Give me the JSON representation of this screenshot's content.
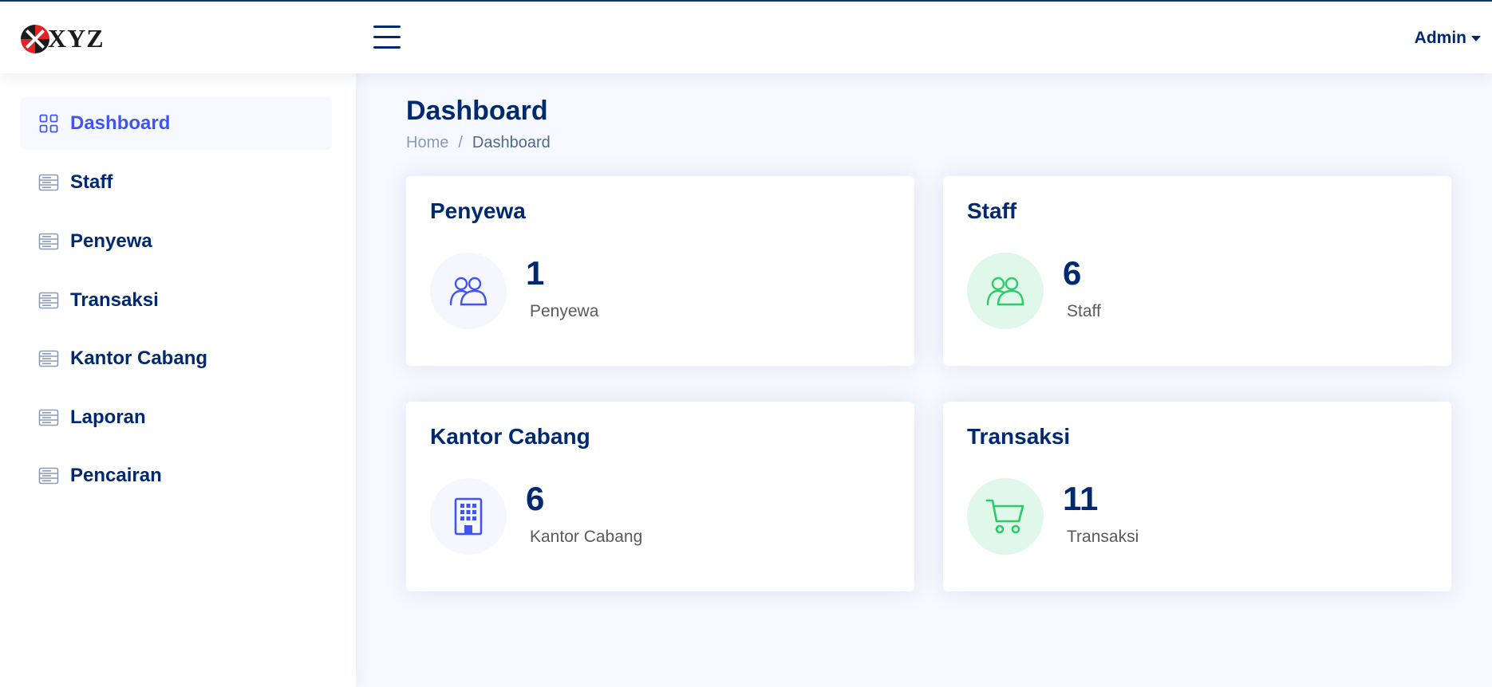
{
  "brand": {
    "logo_text": "XYZ"
  },
  "header": {
    "user_menu_label": "Admin"
  },
  "sidebar": {
    "items": [
      {
        "label": "Dashboard",
        "icon": "grid-icon",
        "active": true
      },
      {
        "label": "Staff",
        "icon": "menu-list-icon"
      },
      {
        "label": "Penyewa",
        "icon": "menu-list-icon"
      },
      {
        "label": "Transaksi",
        "icon": "menu-list-icon"
      },
      {
        "label": "Kantor Cabang",
        "icon": "menu-list-icon"
      },
      {
        "label": "Laporan",
        "icon": "menu-list-icon"
      },
      {
        "label": "Pencairan",
        "icon": "menu-list-icon"
      }
    ]
  },
  "page": {
    "title": "Dashboard",
    "breadcrumb": {
      "home": "Home",
      "separator": "/",
      "current": "Dashboard"
    }
  },
  "cards": [
    {
      "title": "Penyewa",
      "value": "1",
      "label": "Penyewa",
      "icon": "people-icon",
      "accent": "#4154f1"
    },
    {
      "title": "Staff",
      "value": "6",
      "label": "Staff",
      "icon": "people-icon",
      "accent": "#2eca6a"
    },
    {
      "title": "Kantor Cabang",
      "value": "6",
      "label": "Kantor Cabang",
      "icon": "building-icon",
      "accent": "#4154f1"
    },
    {
      "title": "Transaksi",
      "value": "11",
      "label": "Transaksi",
      "icon": "cart-icon",
      "accent": "#2eca6a"
    }
  ],
  "colors": {
    "primary": "#012970",
    "active": "#4154f1",
    "green": "#2eca6a",
    "background": "#f6f9ff"
  }
}
